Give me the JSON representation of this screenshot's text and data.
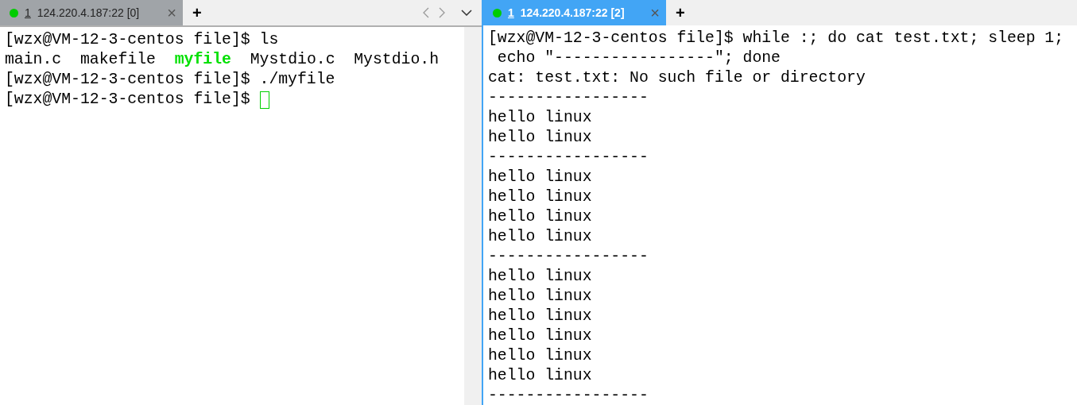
{
  "panes": [
    {
      "tab": {
        "number": "1",
        "label": "124.220.4.187:22 [0]",
        "selected": false,
        "color": "#00cc00",
        "close": "×"
      },
      "new_tab": "+",
      "scrollbar": true,
      "lines": [
        {
          "parts": [
            {
              "text": "[wzx@VM-12-3-centos file]$ ls",
              "kind": "plain"
            }
          ]
        },
        {
          "parts": [
            {
              "text": "main.c  makefile  ",
              "kind": "plain"
            },
            {
              "text": "myfile",
              "kind": "executable"
            },
            {
              "text": "  Mystdio.c  Mystdio.h",
              "kind": "plain"
            }
          ]
        },
        {
          "parts": [
            {
              "text": "[wzx@VM-12-3-centos file]$ ./myfile",
              "kind": "plain"
            }
          ]
        },
        {
          "parts": [
            {
              "text": "[wzx@VM-12-3-centos file]$ ",
              "kind": "plain"
            }
          ],
          "cursor": true
        }
      ]
    },
    {
      "tab": {
        "number": "1",
        "label": "124.220.4.187:22 [2]",
        "selected": true,
        "color": "#00cc00",
        "close": "×"
      },
      "new_tab": "+",
      "scrollbar": false,
      "lines": [
        {
          "parts": [
            {
              "text": "[wzx@VM-12-3-centos file]$ while :; do cat test.txt; sleep 1;",
              "kind": "plain"
            }
          ]
        },
        {
          "parts": [
            {
              "text": " echo \"-----------------\"; done",
              "kind": "plain"
            }
          ]
        },
        {
          "parts": [
            {
              "text": "cat: test.txt: No such file or directory",
              "kind": "plain"
            }
          ]
        },
        {
          "parts": [
            {
              "text": "-----------------",
              "kind": "plain"
            }
          ]
        },
        {
          "parts": [
            {
              "text": "hello linux",
              "kind": "plain"
            }
          ]
        },
        {
          "parts": [
            {
              "text": "hello linux",
              "kind": "plain"
            }
          ]
        },
        {
          "parts": [
            {
              "text": "-----------------",
              "kind": "plain"
            }
          ]
        },
        {
          "parts": [
            {
              "text": "hello linux",
              "kind": "plain"
            }
          ]
        },
        {
          "parts": [
            {
              "text": "hello linux",
              "kind": "plain"
            }
          ]
        },
        {
          "parts": [
            {
              "text": "hello linux",
              "kind": "plain"
            }
          ]
        },
        {
          "parts": [
            {
              "text": "hello linux",
              "kind": "plain"
            }
          ]
        },
        {
          "parts": [
            {
              "text": "-----------------",
              "kind": "plain"
            }
          ]
        },
        {
          "parts": [
            {
              "text": "hello linux",
              "kind": "plain"
            }
          ]
        },
        {
          "parts": [
            {
              "text": "hello linux",
              "kind": "plain"
            }
          ]
        },
        {
          "parts": [
            {
              "text": "hello linux",
              "kind": "plain"
            }
          ]
        },
        {
          "parts": [
            {
              "text": "hello linux",
              "kind": "plain"
            }
          ]
        },
        {
          "parts": [
            {
              "text": "hello linux",
              "kind": "plain"
            }
          ]
        },
        {
          "parts": [
            {
              "text": "hello linux",
              "kind": "plain"
            }
          ]
        },
        {
          "parts": [
            {
              "text": "-----------------",
              "kind": "plain"
            }
          ]
        }
      ]
    }
  ]
}
